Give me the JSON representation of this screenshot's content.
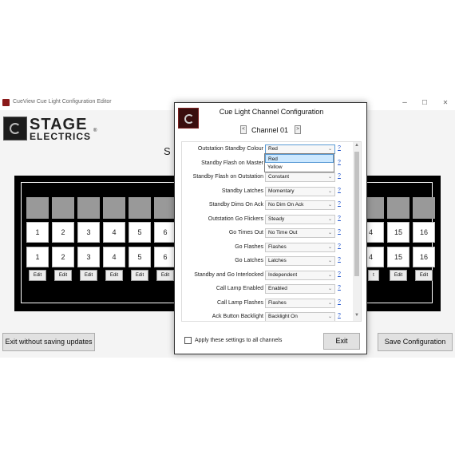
{
  "main_window": {
    "title": "CueView Cue Light Configuration Editor",
    "controls": {
      "minimize": "–",
      "maximize": "☐",
      "close": "✕"
    },
    "logo": {
      "line1": "STAGE",
      "line2": "ELECTRICS",
      "reg": "®"
    },
    "heading_peek": "S",
    "channels": {
      "left_numbers": [
        "1",
        "2",
        "3",
        "4",
        "5",
        "6"
      ],
      "right_numbers": [
        "15",
        "16"
      ],
      "right_partial": "t",
      "right_partial_num": "4",
      "edit_label": "Edit"
    },
    "exit_button": "Exit without saving updates",
    "save_button": "Save Configuration"
  },
  "dialog": {
    "title": "Cue Light Channel Configuration",
    "channel_label": "Channel 01",
    "prev": "<",
    "next": ">",
    "help": "?",
    "rows": [
      {
        "label": "Outstation Standby Colour",
        "value": "Red"
      },
      {
        "label": "Standby Flash on Master",
        "value": ""
      },
      {
        "label": "Standby Flash on Outstation",
        "value": "Constant"
      },
      {
        "label": "Standby Latches",
        "value": "Momentary"
      },
      {
        "label": "Standby Dims On Ack",
        "value": "No Dim On Ack"
      },
      {
        "label": "Outstation Go Flickers",
        "value": "Steady"
      },
      {
        "label": "Go Times Out",
        "value": "No Time Out"
      },
      {
        "label": "Go Flashes",
        "value": "Flashes"
      },
      {
        "label": "Go Latches",
        "value": "Latches"
      },
      {
        "label": "Standby and Go Interlocked",
        "value": "Independent"
      },
      {
        "label": "Call Lamp Enabled",
        "value": "Enabled"
      },
      {
        "label": "Call Lamp Flashes",
        "value": "Flashes"
      },
      {
        "label": "Ack Button Backlight",
        "value": "Backlight On"
      }
    ],
    "dropdown_options": [
      "Red",
      "Yellow"
    ],
    "apply_all_label": "Apply these settings to all channels",
    "exit_label": "Exit"
  },
  "colors": {
    "selected_option": "#cce8ff",
    "panel_background": "#000000",
    "lamp_off": "#999999",
    "help_link": "#2255cc"
  }
}
